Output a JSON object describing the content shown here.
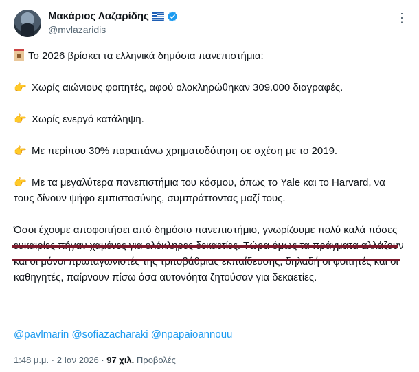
{
  "author": {
    "display_name": "Μακάριος Λαζαρίδης",
    "handle": "@mvlazaridis",
    "flag_icon": "greece-flag-icon",
    "verified_icon": "verified-badge-icon",
    "verified_color": "#1d9bf0",
    "more_label": "⋮"
  },
  "tweet": {
    "intro": "Το 2026 βρίσκει τα ελληνικά δημόσια πανεπιστήμια:",
    "bullets": [
      "Χωρίς αιώνιους φοιτητές, αφού ολοκληρώθηκαν 309.000 διαγραφές.",
      "Χωρίς ενεργό κατάληψη.",
      "Με περίπου 30% παραπάνω χρηματοδότηση σε σχέση με το 2019.",
      "Με τα μεγαλύτερα πανεπιστήμια του κόσμου, όπως το Yale και το Harvard, να τους δίνουν ψήφο εμπιστοσύνης, συμπράττοντας μαζί τους."
    ],
    "closing": "Όσοι έχουμε αποφοιτήσει από δημόσιο πανεπιστήμιο, γνωρίζουμε πολύ καλά πόσες ευκαιρίες πήγαν χαμένες για ολόκληρες δεκαετίες. Τώρα όμως τα πράγματα αλλάζουν και οι μόνοι πρωταγωνιστές της τριτοβάθμιας εκπαίδευσης, δηλαδή οι φοιτητές και οι καθηγητές, παίρνουν πίσω όσα αυτονόητα ζητούσαν για δεκαετίες.",
    "mentions": [
      "@pavlmarin",
      "@sofiazacharaki",
      "@npapaioannouu"
    ],
    "bullet_icon": "pointing-hand-icon",
    "intro_icon": "school-building-icon",
    "mention_color": "#1d9bf0",
    "annotation_color": "#7c1a2c"
  },
  "meta": {
    "time": "1:48 μ.μ.",
    "separator": " · ",
    "date": "2 Ιαν 2026",
    "views_count": "97 χιλ.",
    "views_label": "Προβολές"
  }
}
